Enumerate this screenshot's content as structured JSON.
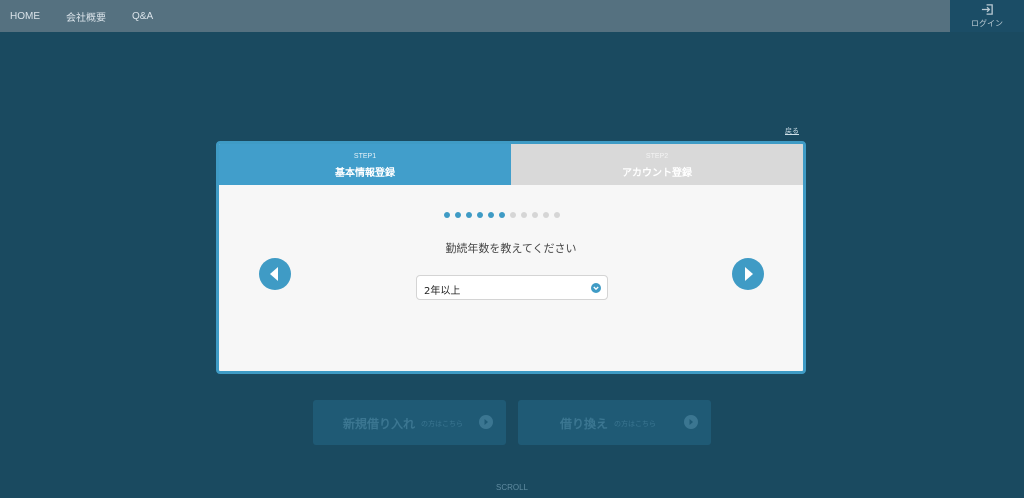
{
  "nav": {
    "items": [
      {
        "label": "HOME"
      },
      {
        "label": "会社概要"
      },
      {
        "label": "Q&A"
      }
    ],
    "login_label": "ログイン"
  },
  "back_link": "戻る",
  "steps": [
    {
      "step": "STEP1",
      "title": "基本情報登録",
      "active": true
    },
    {
      "step": "STEP2",
      "title": "アカウント登録",
      "active": false
    }
  ],
  "progress": {
    "completed": 6,
    "total": 11
  },
  "question": "勤続年数を教えてください",
  "select": {
    "value": "2年以上"
  },
  "cta": {
    "new_main": "新規借り入れ",
    "new_sub": "の方はこちら",
    "refi_main": "借り換え",
    "refi_sub": "の方はこちら"
  },
  "scroll_label": "SCROLL",
  "colors": {
    "background": "#1a4a60",
    "accent": "#419ecb",
    "topbar": "#557180",
    "inactive_tab": "#d9d9d9"
  },
  "icons": {
    "login": "login-icon",
    "prev": "chevron-left-icon",
    "next": "chevron-right-icon",
    "select": "chevron-down-icon",
    "cta": "arrow-right-circle-icon"
  }
}
